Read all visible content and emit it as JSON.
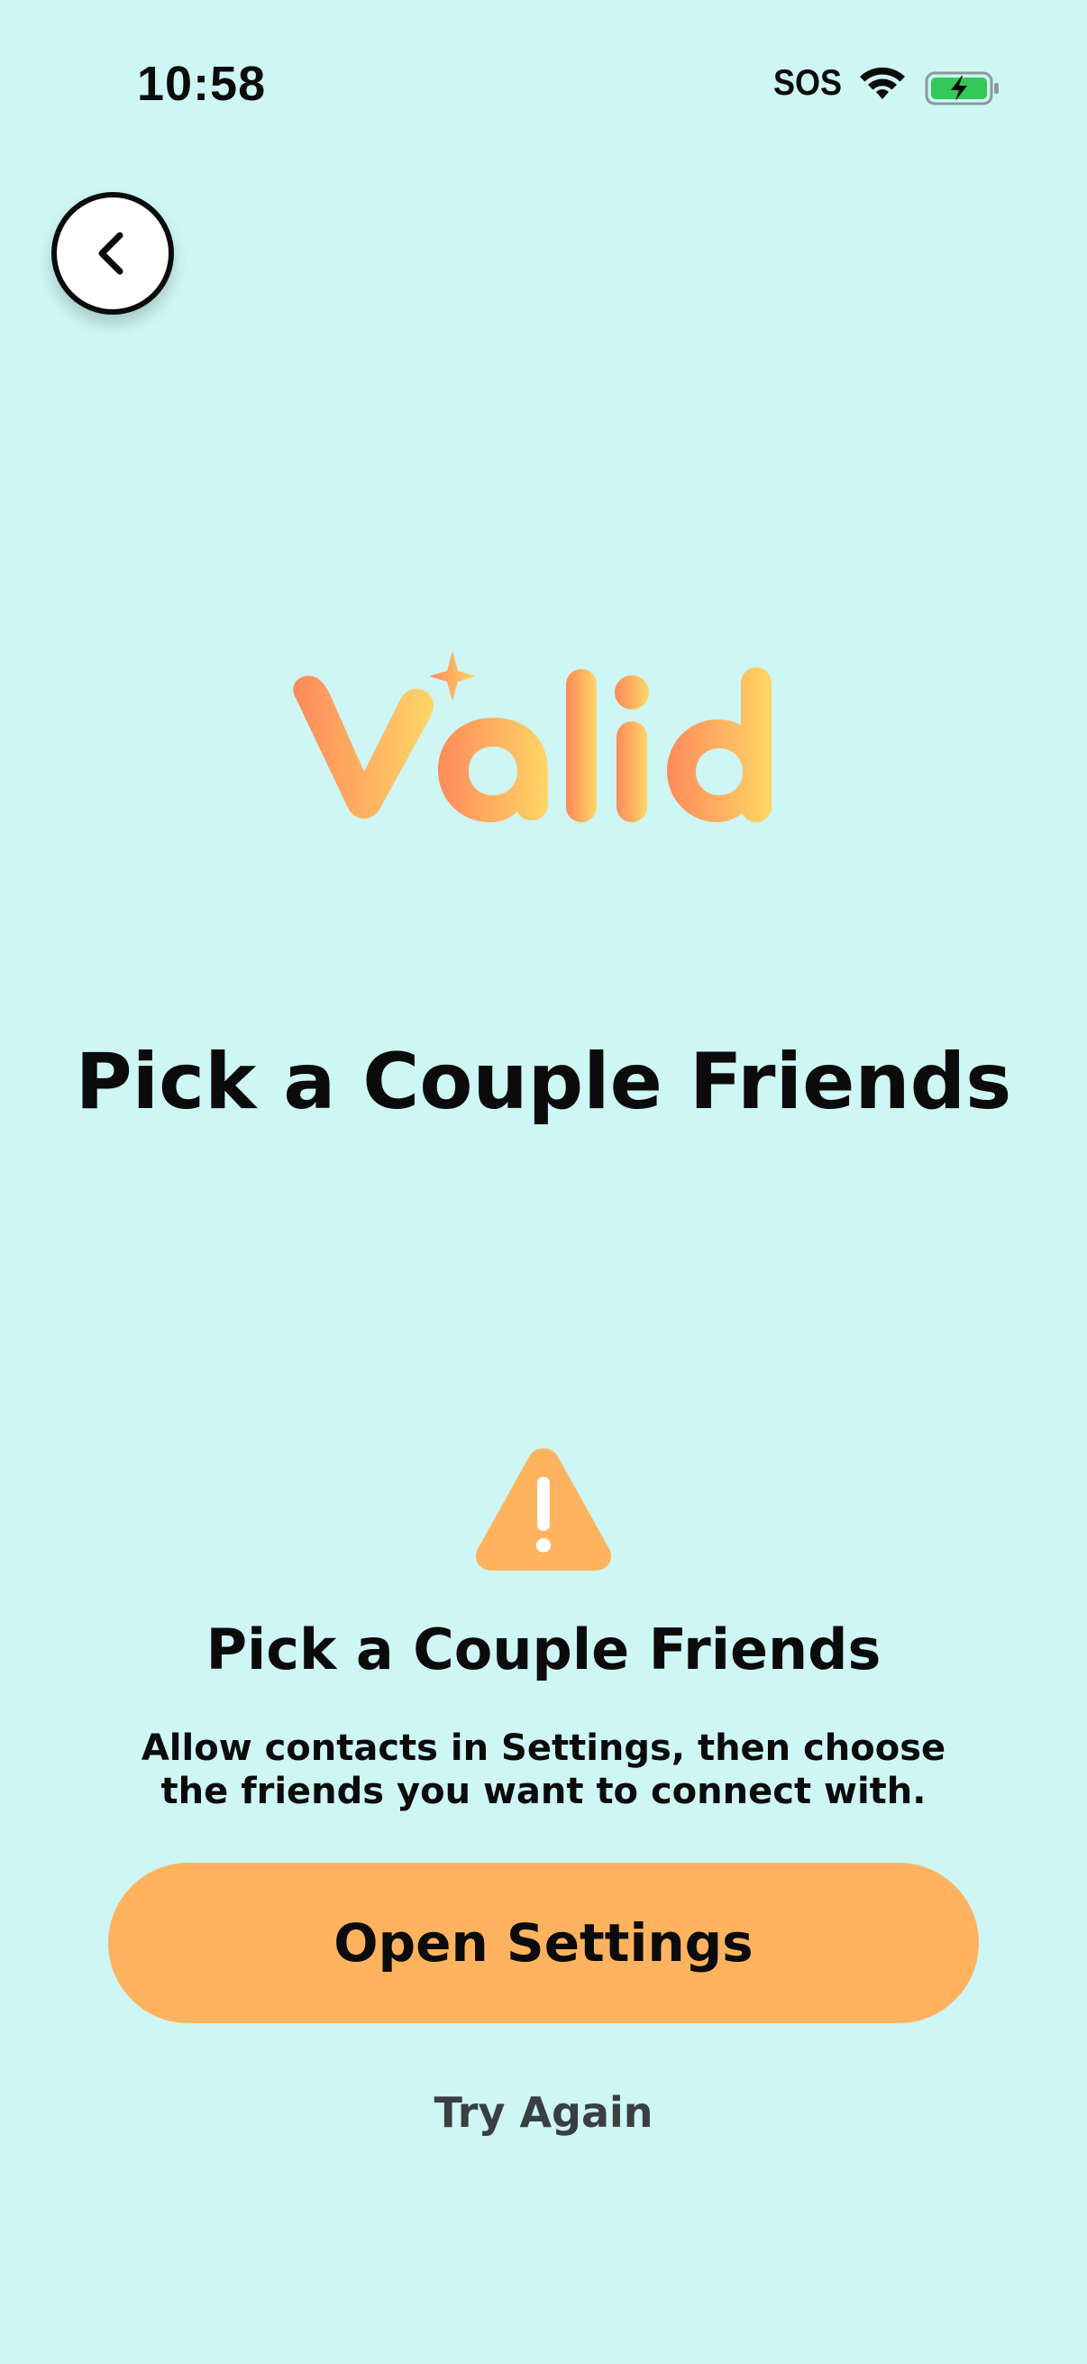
{
  "status_bar": {
    "time": "10:58",
    "sos": "SOS",
    "wifi_icon": "wifi-icon",
    "battery_icon": "battery-charging-icon",
    "battery_color": "#34c759"
  },
  "header": {
    "back_icon": "chevron-left-icon"
  },
  "logo": {
    "text": "Valid",
    "gradient_start": "#ff8a5c",
    "gradient_end": "#ffd666"
  },
  "page_title": "Pick a Couple Friends",
  "permission_notice": {
    "icon": "warning-icon",
    "icon_color": "#ffb35f",
    "title": "Pick a Couple Friends",
    "description": "Allow contacts in Settings, then choose the friends you want to connect with."
  },
  "actions": {
    "primary_label": "Open Settings",
    "primary_color": "#ffb35f",
    "secondary_label": "Try Again"
  },
  "colors": {
    "background": "#cdf6f4",
    "text": "#0b0b0b"
  }
}
